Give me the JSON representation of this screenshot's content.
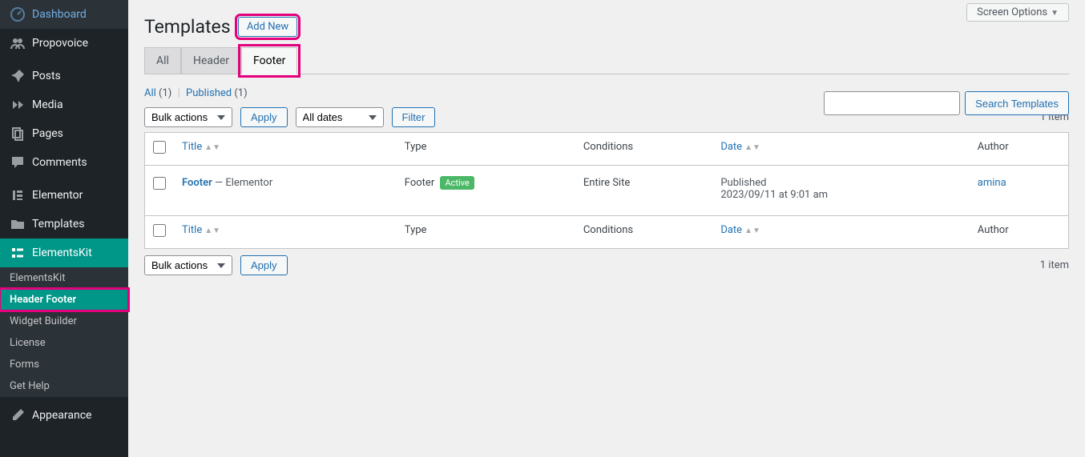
{
  "screen_options": "Screen Options",
  "sidebar": {
    "items": [
      {
        "label": "Dashboard",
        "icon": "dashboard"
      },
      {
        "label": "Propovoice",
        "icon": "users"
      },
      {
        "label": "Posts",
        "icon": "pin"
      },
      {
        "label": "Media",
        "icon": "media"
      },
      {
        "label": "Pages",
        "icon": "pages"
      },
      {
        "label": "Comments",
        "icon": "comment"
      },
      {
        "label": "Elementor",
        "icon": "elementor"
      },
      {
        "label": "Templates",
        "icon": "folder"
      },
      {
        "label": "ElementsKit",
        "icon": "ekit"
      },
      {
        "label": "Appearance",
        "icon": "brush"
      }
    ],
    "sub": [
      {
        "label": "ElementsKit"
      },
      {
        "label": "Header Footer"
      },
      {
        "label": "Widget Builder"
      },
      {
        "label": "License"
      },
      {
        "label": "Forms"
      },
      {
        "label": "Get Help"
      }
    ]
  },
  "page_title": "Templates",
  "add_new": "Add New",
  "tabs": [
    {
      "label": "All",
      "active": false
    },
    {
      "label": "Header",
      "active": false
    },
    {
      "label": "Footer",
      "active": true
    }
  ],
  "filters": {
    "all_label": "All",
    "all_count": "(1)",
    "published_label": "Published",
    "published_count": "(1)"
  },
  "bulk_actions": "Bulk actions",
  "apply": "Apply",
  "all_dates": "All dates",
  "filter": "Filter",
  "item_count": "1 item",
  "search_btn": "Search Templates",
  "columns": {
    "title": "Title",
    "type": "Type",
    "conditions": "Conditions",
    "date": "Date",
    "author": "Author"
  },
  "rows": [
    {
      "title": "Footer",
      "title_suffix": " — Elementor",
      "type": "Footer",
      "badge": "Active",
      "conditions": "Entire Site",
      "date_status": "Published",
      "date_text": "2023/09/11 at 9:01 am",
      "author": "amina"
    }
  ]
}
